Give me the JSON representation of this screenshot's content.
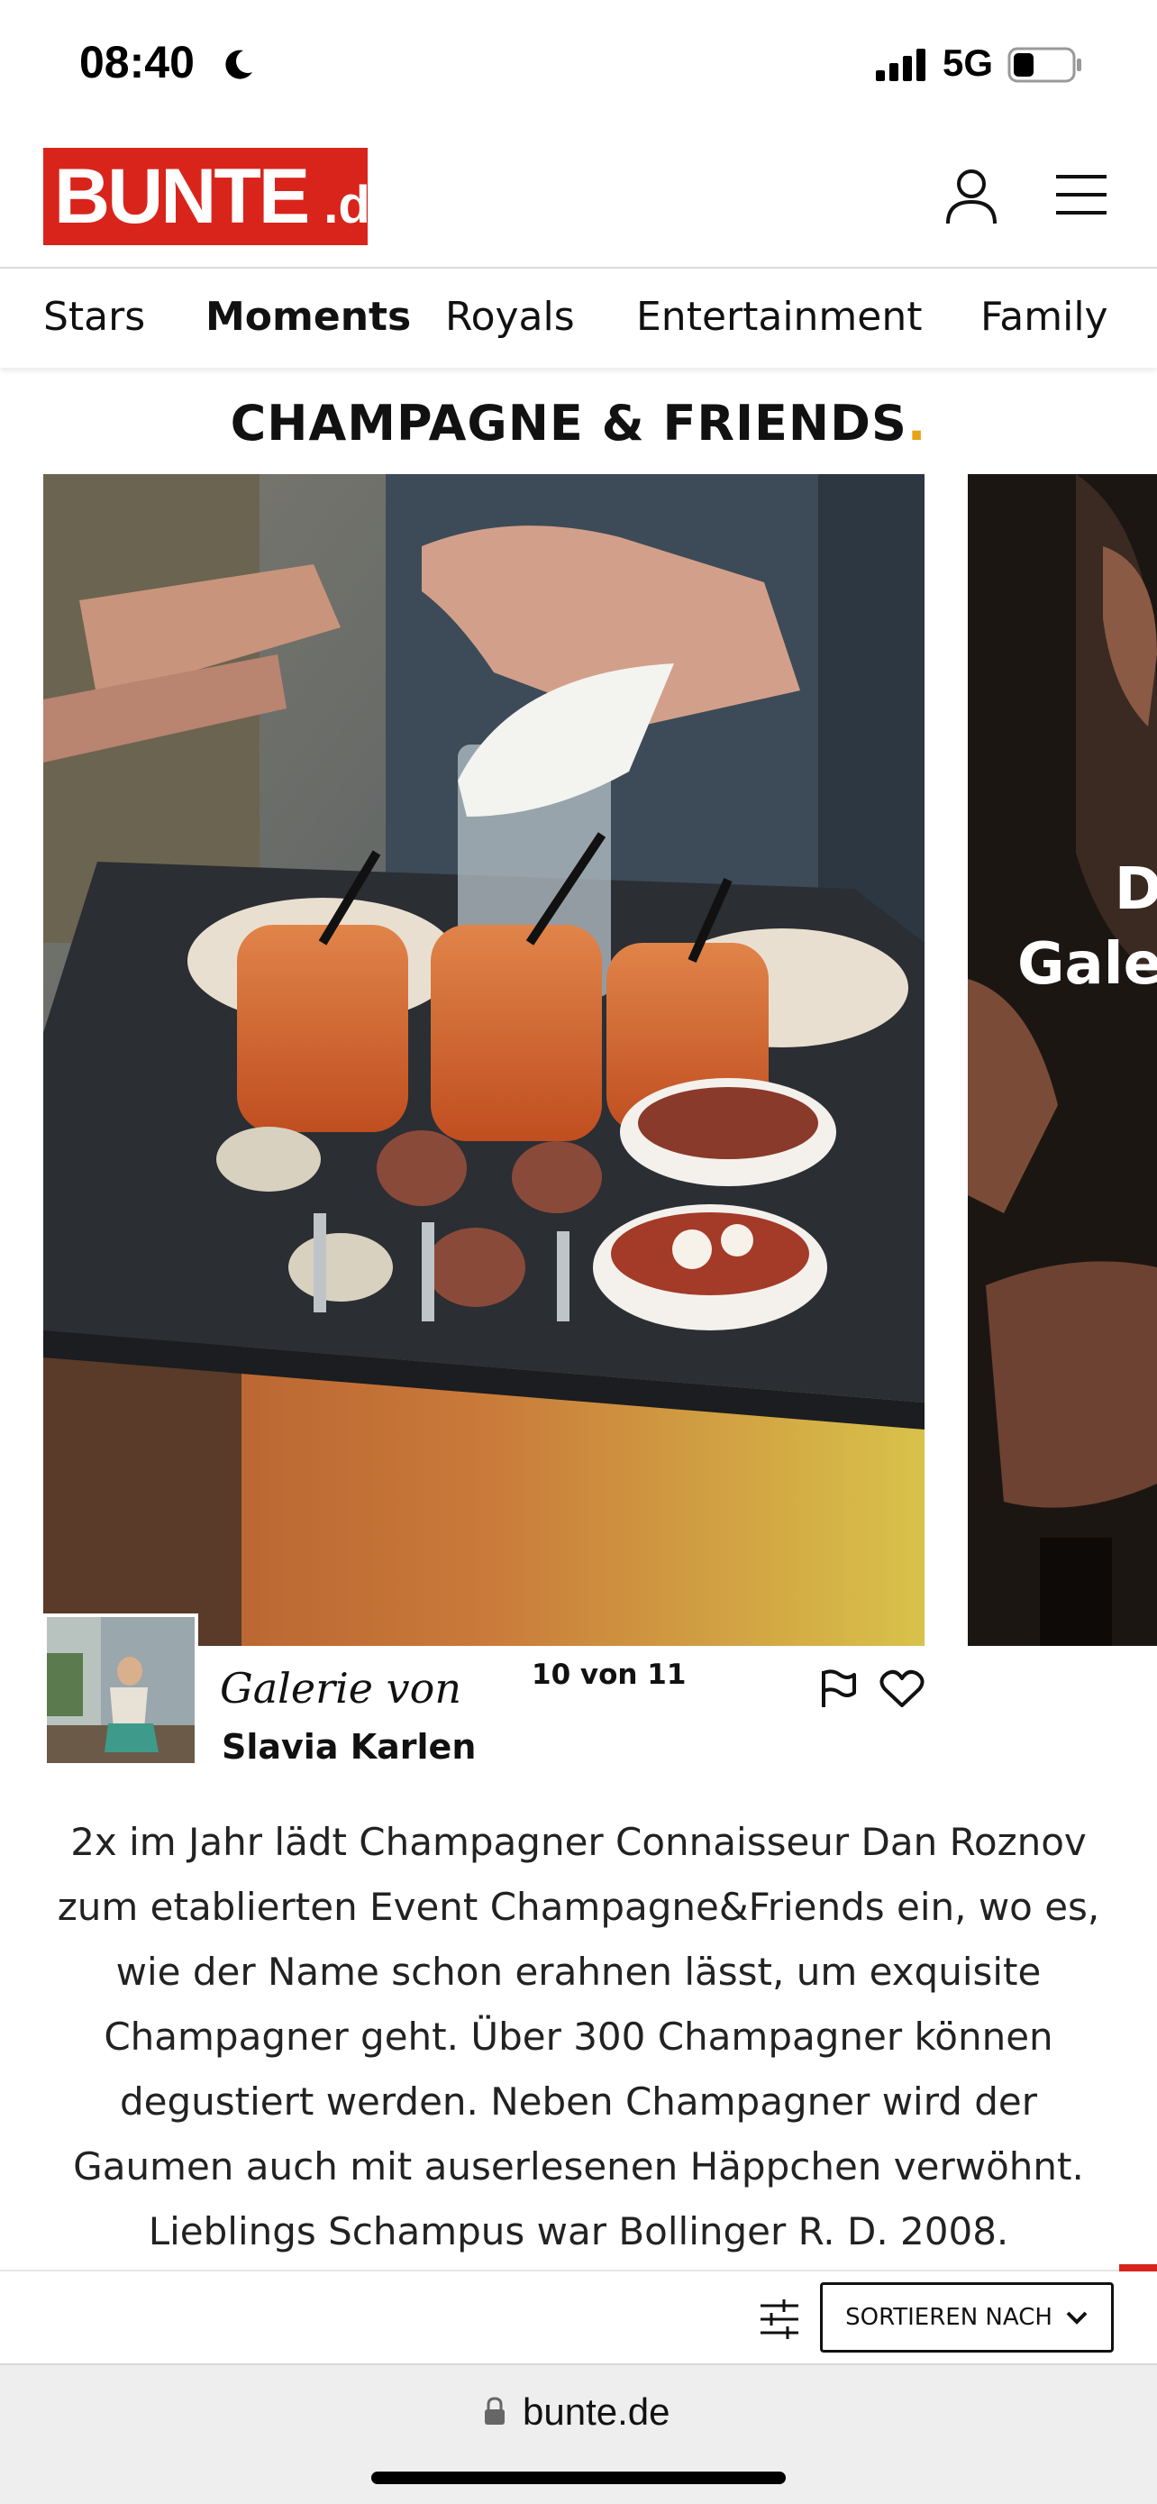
{
  "status_bar": {
    "time": "08:40",
    "network": "5G"
  },
  "header": {
    "logo_main": "BUNTE",
    "logo_sub": ".de",
    "brand_color": "#d9241c"
  },
  "nav": {
    "tabs": [
      {
        "label": "Stars",
        "active": false
      },
      {
        "label": "Moments",
        "active": true
      },
      {
        "label": "Royals",
        "active": false
      },
      {
        "label": "Entertainment",
        "active": false
      },
      {
        "label": "Family",
        "active": false
      }
    ]
  },
  "section": {
    "title": "CHAMPAGNE & FRIENDS",
    "title_dot": "."
  },
  "gallery": {
    "next_caption_line1": "D",
    "next_caption_line2": "Gale",
    "counter": "10 von 11",
    "author_prefix": "Galerie von",
    "author_name": "Slavia Karlen",
    "description": "2x im Jahr lädt Champagner Connaisseur Dan Roznov zum etablierten Event Champagne&Friends ein, wo es, wie der Name schon erahnen lässt, um exquisite Champagner geht. Über 300 Champagner können degustiert werden. Neben Champagner wird der Gaumen auch mit auserlesenen Häppchen verwöhnt. Lieblings Schampus war Bollinger R. D. 2008."
  },
  "sort_bar": {
    "sort_label": "SORTIEREN NACH"
  },
  "browser": {
    "url": "bunte.de"
  }
}
